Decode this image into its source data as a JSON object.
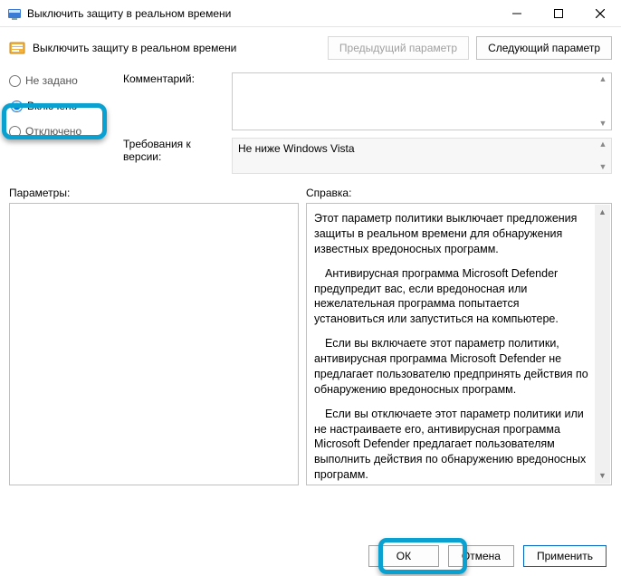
{
  "window": {
    "title": "Выключить защиту в реальном времени"
  },
  "header": {
    "title": "Выключить защиту в реальном времени",
    "prev": "Предыдущий параметр",
    "next": "Следующий параметр"
  },
  "state": {
    "not_configured": "Не задано",
    "enabled": "Включено",
    "disabled": "Отключено",
    "selected": "enabled"
  },
  "meta": {
    "comment_label": "Комментарий:",
    "comment_value": "",
    "version_label": "Требования к версии:",
    "version_value": "Не ниже Windows Vista"
  },
  "labels": {
    "options": "Параметры:",
    "help": "Справка:"
  },
  "help": {
    "p1": "Этот параметр политики выключает предложения защиты в реальном времени для обнаружения известных вредоносных программ.",
    "p2": "Антивирусная программа Microsoft Defender предупредит вас, если вредоносная или нежелательная программа попытается установиться или запуститься на компьютере.",
    "p3": "Если вы включаете этот параметр политики, антивирусная программа Microsoft Defender не предлагает пользователю предпринять действия по обнаружению вредоносных программ.",
    "p4": "Если вы отключаете этот параметр политики или не настраиваете его, антивирусная программа Microsoft Defender предлагает пользователям выполнить действия по обнаружению вредоносных программ."
  },
  "footer": {
    "ok": "ОК",
    "cancel": "Отмена",
    "apply": "Применить"
  }
}
